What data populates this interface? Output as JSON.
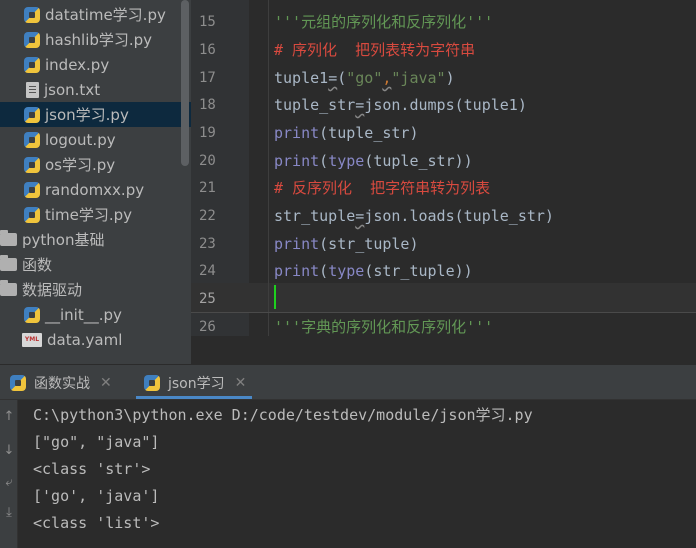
{
  "project_tree": {
    "items": [
      {
        "label": "datatime学习.py",
        "icon": "python-file-icon"
      },
      {
        "label": "hashlib学习.py",
        "icon": "python-file-icon"
      },
      {
        "label": "index.py",
        "icon": "python-file-icon"
      },
      {
        "label": "json.txt",
        "icon": "text-file-icon"
      },
      {
        "label": "json学习.py",
        "icon": "python-file-icon",
        "selected": true
      },
      {
        "label": "logout.py",
        "icon": "python-file-icon"
      },
      {
        "label": "os学习.py",
        "icon": "python-file-icon"
      },
      {
        "label": "randomxx.py",
        "icon": "python-file-icon"
      },
      {
        "label": "time学习.py",
        "icon": "python-file-icon"
      },
      {
        "label": "python基础",
        "icon": "folder-icon"
      },
      {
        "label": "函数",
        "icon": "folder-icon"
      },
      {
        "label": "数据驱动",
        "icon": "folder-icon"
      },
      {
        "label": "__init__.py",
        "icon": "python-file-icon"
      },
      {
        "label": "data.yaml",
        "icon": "yaml-file-icon"
      }
    ]
  },
  "editor": {
    "line_numbers": [
      "15",
      "16",
      "17",
      "18",
      "19",
      "20",
      "21",
      "22",
      "23",
      "24",
      "25",
      "26"
    ],
    "lines": {
      "l15": {
        "doc": "'''元组的序列化和反序列化'''"
      },
      "l16": {
        "comment": "# 序列化  把列表转为字符串"
      },
      "l17": {
        "a": "tuple1",
        "b": "=",
        "c": "(",
        "d": "\"go\"",
        "e": ",",
        "f": "\"java\"",
        "g": ")"
      },
      "l18": {
        "a": "tuple_str",
        "b": "=",
        "c": "json.dumps(tuple1)"
      },
      "l19": {
        "a": "print",
        "b": "(tuple_str)"
      },
      "l20": {
        "a": "print",
        "b": "(",
        "c": "type",
        "d": "(tuple_str))"
      },
      "l21": {
        "comment": "# 反序列化  把字符串转为列表"
      },
      "l22": {
        "a": "str_tuple",
        "b": "=",
        "c": "json.loads(tuple_str)"
      },
      "l23": {
        "a": "print",
        "b": "(str_tuple)"
      },
      "l24": {
        "a": "print",
        "b": "(",
        "c": "type",
        "d": "(str_tuple))"
      },
      "l25": {},
      "l26": {
        "doc": "'''字典的序列化和反序列化'''"
      }
    }
  },
  "run_panel": {
    "tabs": [
      {
        "label": "函数实战",
        "close": "✕"
      },
      {
        "label": "json学习",
        "close": "✕",
        "active": true
      }
    ],
    "output": [
      "C:\\python3\\python.exe D:/code/testdev/module/json学习.py",
      "[\"go\", \"java\"]",
      "<class 'str'>",
      "['go', 'java']",
      "<class 'list'>"
    ]
  },
  "colors": {
    "keyword": "#cc7832",
    "string": "#6a8759",
    "builtin": "#8888c6",
    "comment": "#d84a3f",
    "docstring": "#629755",
    "caret": "#1ed01e"
  }
}
